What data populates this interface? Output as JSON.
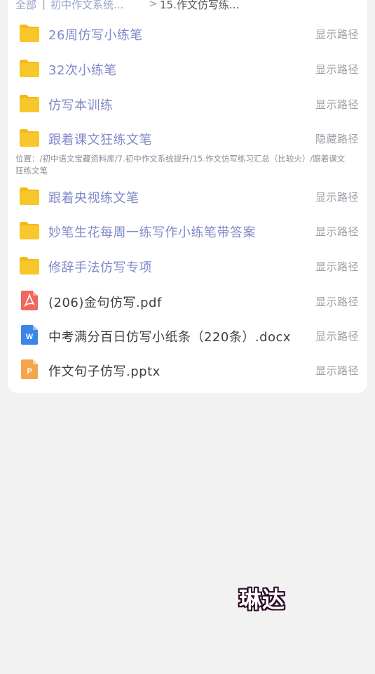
{
  "breadcrumb": {
    "root": "全部",
    "divider": "|",
    "level1": "初中作文系统...",
    "arrow": ">",
    "current": "15.作文仿写练..."
  },
  "rows": [
    {
      "type": "folder",
      "name": "26周仿写小练笔",
      "action": "显示路径"
    },
    {
      "type": "folder",
      "name": "32次小练笔",
      "action": "显示路径"
    },
    {
      "type": "folder",
      "name": "仿写本训练",
      "action": "显示路径"
    },
    {
      "type": "folder",
      "name": "跟着课文狂练文笔",
      "action": "隐藏路径"
    },
    {
      "type": "folder",
      "name": "跟着央视练文笔",
      "action": "显示路径"
    },
    {
      "type": "folder",
      "name": "妙笔生花每周一练写作小练笔带答案",
      "action": "显示路径"
    },
    {
      "type": "folder",
      "name": "修辞手法仿写专项",
      "action": "显示路径"
    },
    {
      "type": "pdf",
      "name": "(206)金句仿写.pdf",
      "action": "显示路径"
    },
    {
      "type": "docx",
      "name": "中考满分百日仿写小纸条（220条）.docx",
      "action": "显示路径"
    },
    {
      "type": "pptx",
      "name": "作文句子仿写.pptx",
      "action": "显示路径"
    }
  ],
  "path_note": "位置：/初中语文宝藏资料库/7.初中作文系统提升/15.作文仿写练习汇总（比较火）/跟着课文狂练文笔",
  "icons": {
    "folder": "folder-icon",
    "pdf": "pdf-file-icon",
    "docx": "word-file-icon",
    "pptx": "powerpoint-file-icon"
  },
  "colors": {
    "folder": "#f7c72b",
    "pdf": "#f0675f",
    "docx": "#3c86e8",
    "pptx": "#f5a54b",
    "folder_text": "#7f8ac9"
  },
  "watermark": "琳达"
}
